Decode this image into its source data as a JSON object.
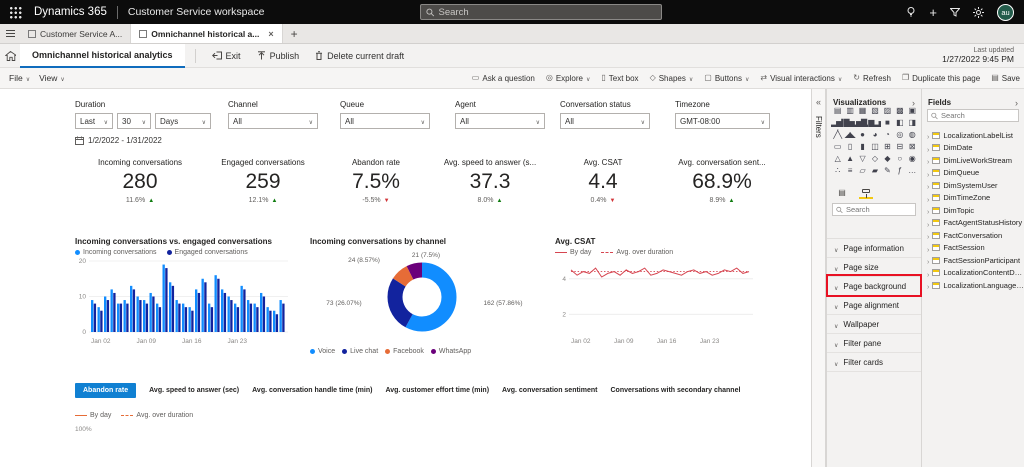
{
  "colors": {
    "accent": "#0f6cbd",
    "positive": "#107C10",
    "negative": "#D13438",
    "highlight": "#E81123"
  },
  "topbar": {
    "brand": "Dynamics 365",
    "app": "Customer Service workspace",
    "search_placeholder": "Search",
    "avatar_initials": "au"
  },
  "browser_tabs": {
    "tab1": "Customer Service A...",
    "tab2": "Omnichannel historical a...",
    "close_glyph": "×",
    "new_tab_glyph": "+"
  },
  "header": {
    "page_tab": "Omnichannel historical analytics",
    "exit_label": "Exit",
    "publish_label": "Publish",
    "delete_label": "Delete current draft",
    "last_updated_label": "Last updated",
    "last_updated_value": "1/27/2022 9:45 PM"
  },
  "ribbon": {
    "file_label": "File",
    "view_label": "View",
    "right_items": [
      {
        "label": "Ask a question",
        "chevron": false,
        "icon": "chat-icon"
      },
      {
        "label": "Explore",
        "chevron": true,
        "icon": "explore-icon"
      },
      {
        "label": "Text box",
        "chevron": false,
        "icon": "textbox-icon"
      },
      {
        "label": "Shapes",
        "chevron": true,
        "icon": "shapes-icon"
      },
      {
        "label": "Buttons",
        "chevron": true,
        "icon": "buttons-icon"
      },
      {
        "label": "Visual interactions",
        "chevron": true,
        "icon": "interactions-icon"
      },
      {
        "label": "Refresh",
        "chevron": false,
        "icon": "refresh-icon"
      },
      {
        "label": "Duplicate this page",
        "chevron": false,
        "icon": "duplicate-icon"
      },
      {
        "label": "Save",
        "chevron": false,
        "icon": "save-icon"
      }
    ]
  },
  "filters": {
    "duration": {
      "label": "Duration",
      "parts": [
        "Last",
        "30",
        "Days"
      ]
    },
    "channel": {
      "label": "Channel",
      "value": "All"
    },
    "queue": {
      "label": "Queue",
      "value": "All"
    },
    "agent": {
      "label": "Agent",
      "value": "All"
    },
    "status": {
      "label": "Conversation status",
      "value": "All"
    },
    "timezone": {
      "label": "Timezone",
      "value": "GMT-08:00"
    },
    "date_range": "1/2/2022 - 1/31/2022"
  },
  "kpis": [
    {
      "title": "Incoming conversations",
      "value": "280",
      "delta": "11.6%",
      "direction": "up"
    },
    {
      "title": "Engaged conversations",
      "value": "259",
      "delta": "12.1%",
      "direction": "up"
    },
    {
      "title": "Abandon rate",
      "value": "7.5%",
      "delta": "-5.5%",
      "direction": "down"
    },
    {
      "title": "Avg. speed to answer (s...",
      "value": "37.3",
      "delta": "8.0%",
      "direction": "up"
    },
    {
      "title": "Avg. CSAT",
      "value": "4.4",
      "delta": "0.4%",
      "direction": "down"
    },
    {
      "title": "Avg. conversation sent...",
      "value": "68.9%",
      "delta": "8.9%",
      "direction": "up"
    }
  ],
  "bottom_tabs": {
    "active": "Abandon rate",
    "active_bg": "#1080d2",
    "items": [
      "Abandon rate",
      "Avg. speed to answer (sec)",
      "Avg. conversation handle time (min)",
      "Avg. customer effort time (min)",
      "Avg. conversation sentiment",
      "Conversations with secondary channel"
    ]
  },
  "filters_rail_label": "Filters",
  "vis_panel": {
    "title": "Visualizations",
    "search_placeholder": "Search",
    "highlighted_section": "Page background",
    "sections": [
      "Page information",
      "Page size",
      "Page background",
      "Page alignment",
      "Wallpaper",
      "Filter pane",
      "Filter cards"
    ],
    "icons": [
      "▤",
      "▥",
      "▦",
      "▧",
      "▨",
      "▩",
      "▣",
      "▂▅▇",
      "▇▅▂",
      "▅▇▂",
      "▆▂▅",
      "■",
      "◧",
      "◨",
      "╱╲",
      "◢◣",
      "●",
      "◕",
      "◔",
      "◎",
      "◍",
      "▭",
      "▯",
      "▮",
      "◫",
      "⊞",
      "⊟",
      "⊠",
      "△",
      "▲",
      "▽",
      "◇",
      "◆",
      "○",
      "◉",
      "∴",
      "≡",
      "▱",
      "▰",
      "✎",
      "ƒ",
      "…"
    ]
  },
  "fields_panel": {
    "title": "Fields",
    "search_placeholder": "Search",
    "items": [
      "LocalizationLabelList",
      "DimDate",
      "DimLiveWorkStream",
      "DimQueue",
      "DimSystemUser",
      "DimTimeZone",
      "DimTopic",
      "FactAgentStatusHistory",
      "FactConversation",
      "FactSession",
      "FactSessionParticipant",
      "LocalizationContentDe...",
      "LocalizationLanguageL..."
    ]
  },
  "chart_data": [
    {
      "type": "bar",
      "title": "Incoming conversations vs. engaged conversations",
      "x_range": [
        "Jan 02",
        "Jan 31"
      ],
      "x_ticks": [
        "Jan 02",
        "Jan 09",
        "Jan 16",
        "Jan 23"
      ],
      "tick_indices": [
        0,
        7,
        14,
        21
      ],
      "ylim": [
        0,
        20
      ],
      "yticks": [
        0,
        10,
        20
      ],
      "legend_position": "top",
      "series": [
        {
          "name": "Incoming conversations",
          "color": "#118DFF",
          "values": [
            9,
            7,
            10,
            12,
            8,
            9,
            13,
            10,
            9,
            11,
            8,
            19,
            14,
            9,
            8,
            7,
            12,
            15,
            8,
            16,
            12,
            10,
            8,
            13,
            9,
            8,
            11,
            7,
            6,
            9
          ]
        },
        {
          "name": "Engaged conversations",
          "color": "#12239E",
          "values": [
            8,
            6,
            9,
            11,
            8,
            8,
            12,
            9,
            8,
            10,
            7,
            18,
            13,
            8,
            7,
            6,
            11,
            14,
            7,
            15,
            11,
            9,
            7,
            12,
            8,
            7,
            10,
            6,
            5,
            8
          ]
        }
      ]
    },
    {
      "type": "donut",
      "title": "Incoming conversations by channel",
      "legend_position": "bottom",
      "slices": [
        {
          "label": "Voice",
          "value": 162,
          "pct": "57.86%",
          "color": "#118DFF"
        },
        {
          "label": "Live chat",
          "value": 73,
          "pct": "26.07%",
          "color": "#12239E"
        },
        {
          "label": "Facebook",
          "value": 24,
          "pct": "8.57%",
          "color": "#E66C37"
        },
        {
          "label": "WhatsApp",
          "value": 21,
          "pct": "7.5%",
          "color": "#6B007B"
        }
      ]
    },
    {
      "type": "line",
      "title": "Avg. CSAT",
      "x_ticks": [
        "Jan 02",
        "Jan 09",
        "Jan 16",
        "Jan 23"
      ],
      "tick_indices": [
        0,
        7,
        14,
        21
      ],
      "ylim": [
        1,
        5
      ],
      "yticks": [
        2,
        4
      ],
      "legend_position": "top",
      "series": [
        {
          "name": "By day",
          "color": "#D64550",
          "style": "solid",
          "values": [
            4.5,
            4.2,
            4.4,
            4.3,
            4.6,
            4.1,
            4.3,
            4.4,
            4.2,
            4.5,
            4.3,
            4.4,
            4.6,
            4.2,
            4.3,
            4.5,
            4.4,
            4.3,
            4.2,
            4.4,
            4.5,
            4.3,
            4.4,
            4.2,
            4.3,
            4.5,
            4.4,
            4.6,
            4.3,
            4.4
          ]
        },
        {
          "name": "Avg. over duration",
          "color": "#D64550",
          "style": "dotted",
          "value": 4.4
        }
      ]
    },
    {
      "type": "line",
      "title": "Abandon rate",
      "note": "only legend and top of y-axis visible below fold",
      "legend": [
        "By day",
        "Avg. over duration"
      ],
      "color": "#E66C37",
      "y_first_tick": "100%"
    }
  ]
}
